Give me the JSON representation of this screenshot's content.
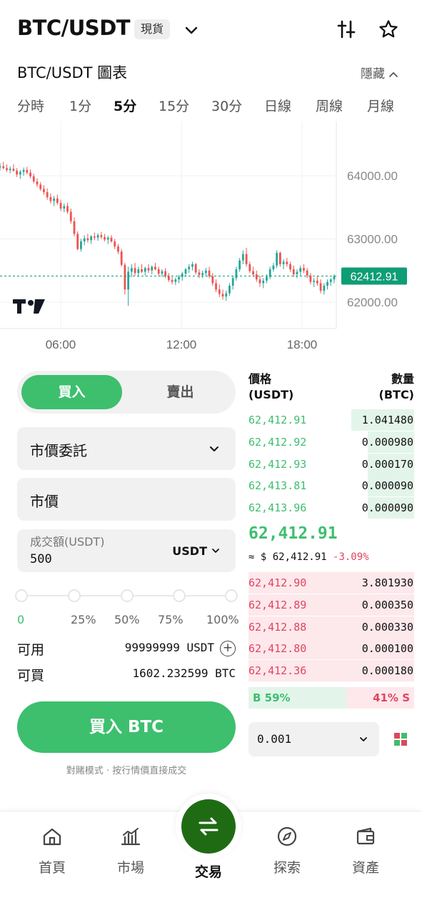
{
  "header": {
    "pair": "BTC/USDT",
    "market_badge": "現貨",
    "icons": {
      "dropdown": "chevron-down-icon",
      "settings": "adjust-sliders-icon",
      "favorite": "star-icon"
    }
  },
  "chart_header": {
    "title": "BTC/USDT 圖表",
    "hide_label": "隱藏"
  },
  "timeframes": [
    {
      "label": "分時",
      "active": false
    },
    {
      "label": "1分",
      "active": false
    },
    {
      "label": "5分",
      "active": true
    },
    {
      "label": "15分",
      "active": false
    },
    {
      "label": "30分",
      "active": false
    },
    {
      "label": "日線",
      "active": false
    },
    {
      "label": "周線",
      "active": false
    },
    {
      "label": "月線",
      "active": false
    }
  ],
  "chart": {
    "price_labels": [
      "64000.00",
      "63000.00",
      "62000.00"
    ],
    "price_levels": [
      64000,
      63000,
      62000
    ],
    "current_price": "62412.91",
    "current_value": 62412.91,
    "time_labels": [
      "06:00",
      "12:00",
      "18:00"
    ],
    "up_color": "#26a69a",
    "down_color": "#ef5350",
    "price_tag_color": "#0f9d76",
    "candles": [
      [
        64130,
        64200,
        64080,
        64150
      ],
      [
        64150,
        64220,
        64100,
        64120
      ],
      [
        64120,
        64180,
        64060,
        64090
      ],
      [
        64090,
        64150,
        64040,
        64110
      ],
      [
        64110,
        64180,
        64060,
        64080
      ],
      [
        64080,
        64120,
        63980,
        64020
      ],
      [
        64020,
        64090,
        63950,
        64060
      ],
      [
        64060,
        64130,
        64000,
        64090
      ],
      [
        64090,
        64140,
        64020,
        64050
      ],
      [
        64050,
        64100,
        63960,
        63990
      ],
      [
        63990,
        64030,
        63880,
        63910
      ],
      [
        63910,
        63960,
        63820,
        63860
      ],
      [
        63860,
        63900,
        63760,
        63790
      ],
      [
        63790,
        63850,
        63700,
        63740
      ],
      [
        63740,
        63800,
        63620,
        63660
      ],
      [
        63660,
        63720,
        63560,
        63600
      ],
      [
        63600,
        63680,
        63520,
        63640
      ],
      [
        63640,
        63700,
        63540,
        63570
      ],
      [
        63570,
        63620,
        63440,
        63480
      ],
      [
        63480,
        63560,
        63420,
        63520
      ],
      [
        63520,
        63570,
        63400,
        63430
      ],
      [
        63430,
        63480,
        63240,
        63280
      ],
      [
        63280,
        63340,
        63040,
        63080
      ],
      [
        63080,
        63120,
        62820,
        62840
      ],
      [
        62840,
        63000,
        62800,
        62960
      ],
      [
        62960,
        63060,
        62900,
        63010
      ],
      [
        63010,
        63080,
        62940,
        62980
      ],
      [
        62980,
        63060,
        62920,
        63040
      ],
      [
        63040,
        63100,
        62980,
        63020
      ],
      [
        63020,
        63090,
        62970,
        63060
      ],
      [
        63060,
        63110,
        63000,
        63030
      ],
      [
        63030,
        63080,
        62960,
        62990
      ],
      [
        62990,
        63050,
        62920,
        63020
      ],
      [
        63020,
        63060,
        62940,
        62960
      ],
      [
        62960,
        63000,
        62840,
        62880
      ],
      [
        62880,
        62920,
        62760,
        62800
      ],
      [
        62800,
        62840,
        62560,
        62590
      ],
      [
        62590,
        62620,
        62120,
        62200
      ],
      [
        62200,
        62560,
        61940,
        62480
      ],
      [
        62480,
        62600,
        62400,
        62540
      ],
      [
        62540,
        62620,
        62420,
        62460
      ],
      [
        62460,
        62560,
        62400,
        62520
      ],
      [
        62520,
        62600,
        62460,
        62480
      ],
      [
        62480,
        62560,
        62420,
        62540
      ],
      [
        62540,
        62600,
        62460,
        62500
      ],
      [
        62500,
        62580,
        62440,
        62560
      ],
      [
        62560,
        62620,
        62500,
        62520
      ],
      [
        62520,
        62560,
        62420,
        62450
      ],
      [
        62450,
        62520,
        62400,
        62490
      ],
      [
        62490,
        62540,
        62380,
        62410
      ],
      [
        62410,
        62460,
        62320,
        62350
      ],
      [
        62350,
        62400,
        62280,
        62320
      ],
      [
        62320,
        62390,
        62270,
        62360
      ],
      [
        62360,
        62430,
        62300,
        62400
      ],
      [
        62400,
        62480,
        62340,
        62450
      ],
      [
        62450,
        62540,
        62400,
        62520
      ],
      [
        62520,
        62600,
        62460,
        62560
      ],
      [
        62560,
        62640,
        62500,
        62600
      ],
      [
        62600,
        62620,
        62440,
        62470
      ],
      [
        62470,
        62520,
        62380,
        62430
      ],
      [
        62430,
        62500,
        62380,
        62460
      ],
      [
        62460,
        62540,
        62420,
        62500
      ],
      [
        62500,
        62560,
        62380,
        62410
      ],
      [
        62410,
        62460,
        62260,
        62300
      ],
      [
        62300,
        62360,
        62160,
        62200
      ],
      [
        62200,
        62280,
        62080,
        62130
      ],
      [
        62130,
        62200,
        62040,
        62090
      ],
      [
        62090,
        62180,
        62020,
        62140
      ],
      [
        62140,
        62300,
        62100,
        62260
      ],
      [
        62260,
        62420,
        62200,
        62380
      ],
      [
        62380,
        62560,
        62340,
        62520
      ],
      [
        62520,
        62700,
        62480,
        62660
      ],
      [
        62660,
        62820,
        62600,
        62760
      ],
      [
        62760,
        62860,
        62560,
        62600
      ],
      [
        62600,
        62640,
        62460,
        62490
      ],
      [
        62490,
        62560,
        62400,
        62440
      ],
      [
        62440,
        62500,
        62320,
        62360
      ],
      [
        62360,
        62420,
        62240,
        62300
      ],
      [
        62300,
        62380,
        62220,
        62340
      ],
      [
        62340,
        62440,
        62300,
        62400
      ],
      [
        62400,
        62560,
        62360,
        62520
      ],
      [
        62520,
        62620,
        62480,
        62580
      ],
      [
        62580,
        62820,
        62540,
        62780
      ],
      [
        62780,
        62800,
        62560,
        62600
      ],
      [
        62600,
        62680,
        62520,
        62640
      ],
      [
        62640,
        62700,
        62560,
        62600
      ],
      [
        62600,
        62640,
        62480,
        62520
      ],
      [
        62520,
        62580,
        62400,
        62440
      ],
      [
        62440,
        62520,
        62380,
        62480
      ],
      [
        62480,
        62580,
        62420,
        62540
      ],
      [
        62540,
        62600,
        62460,
        62500
      ],
      [
        62500,
        62540,
        62380,
        62420
      ],
      [
        62420,
        62460,
        62280,
        62320
      ],
      [
        62320,
        62380,
        62240,
        62340
      ],
      [
        62340,
        62420,
        62260,
        62300
      ],
      [
        62300,
        62360,
        62140,
        62180
      ],
      [
        62180,
        62300,
        62120,
        62260
      ],
      [
        62260,
        62360,
        62200,
        62320
      ],
      [
        62320,
        62380,
        62260,
        62360
      ],
      [
        62360,
        62440,
        62300,
        62412
      ]
    ]
  },
  "order_side": {
    "buy": "買入",
    "sell": "賣出"
  },
  "order_form": {
    "order_type": "市價委託",
    "price": "市價",
    "amount_label": "成交額(USDT)",
    "amount_value": "500",
    "amount_unit": "USDT",
    "slider_percent": 0,
    "slider_marks": [
      "0",
      "25%",
      "50%",
      "75%",
      "100%"
    ],
    "available_label": "可用",
    "available_value": "99999999 USDT",
    "buyable_label": "可買",
    "buyable_value": "1602.232599 BTC",
    "submit_label": "買入 BTC",
    "mode_note": "對賭模式 · 按行情價直接成交"
  },
  "order_book": {
    "price_header": "價格\n(USDT)",
    "qty_header": "數量\n(BTC)",
    "price_header_1": "價格",
    "price_header_2": "(USDT)",
    "qty_header_1": "數量",
    "qty_header_2": "(BTC)",
    "bids": [
      {
        "price": "62,412.91",
        "qty": "1.041480",
        "depth": 0.38
      },
      {
        "price": "62,412.92",
        "qty": "0.000980",
        "depth": 0.28
      },
      {
        "price": "62,412.93",
        "qty": "0.000170",
        "depth": 0.28
      },
      {
        "price": "62,413.81",
        "qty": "0.000090",
        "depth": 0.28
      },
      {
        "price": "62,413.96",
        "qty": "0.000090",
        "depth": 0.28
      }
    ],
    "last_price": "62,412.91",
    "last_price_usd": "≈ $ 62,412.91",
    "change": "-3.09%",
    "asks": [
      {
        "price": "62,412.90",
        "qty": "3.801930",
        "depth": 1.0
      },
      {
        "price": "62,412.89",
        "qty": "0.000350",
        "depth": 1.0
      },
      {
        "price": "62,412.88",
        "qty": "0.000330",
        "depth": 1.0
      },
      {
        "price": "62,412.80",
        "qty": "0.000100",
        "depth": 1.0
      },
      {
        "price": "62,412.36",
        "qty": "0.000180",
        "depth": 1.0
      }
    ],
    "buy_ratio_label": "B 59%",
    "sell_ratio_label": "41% S",
    "buy_ratio": 0.59,
    "precision": "0.001",
    "colors": {
      "bid": "#3dbf6e",
      "ask": "#e0455f",
      "bid_bg": "#e3f5ea",
      "ask_bg": "#fde8ec"
    }
  },
  "bottom_nav": [
    {
      "label": "首頁",
      "icon": "home-icon",
      "active": false
    },
    {
      "label": "市場",
      "icon": "market-chart-icon",
      "active": false
    },
    {
      "label": "交易",
      "icon": "swap-arrows-icon",
      "active": true
    },
    {
      "label": "探索",
      "icon": "compass-icon",
      "active": false
    },
    {
      "label": "資產",
      "icon": "wallet-icon",
      "active": false
    }
  ]
}
